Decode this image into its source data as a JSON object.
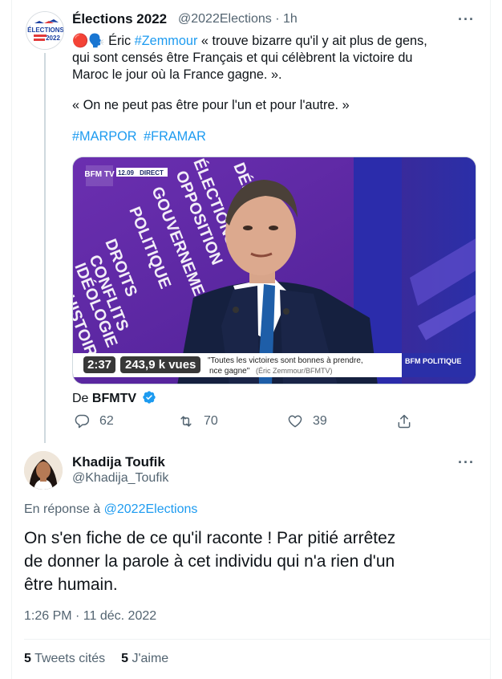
{
  "tweet": {
    "author_name": "Élections 2022",
    "author_handle": "@2022Elections · 1h",
    "text_emoji": "🔴🗣️",
    "text_prefix": "Éric",
    "text_mention": "#Zemmour",
    "text_line1_rest": "« trouve bizarre qu'il y ait plus de gens,",
    "text_line2": "qui sont censés être Français et qui célèbrent la victoire du",
    "text_line3": "Maroc le jour où la France gagne. ».",
    "text_quote": "« On ne peut pas être pour l'un et pour l'autre. »",
    "hashtags": [
      "#MARPOR",
      "#FRAMAR"
    ],
    "video": {
      "duration": "2:37",
      "views": "243,9 k vues",
      "channel_logo": "BFM TV",
      "live_time": "12.09",
      "live_label": "DIRECT",
      "background_words": [
        "DÉBAT",
        "ÉLECTIONS",
        "OPPOSITION",
        "GOUVERNEMENT",
        "POLITIQUE",
        "DROITS",
        "CONFLITS",
        "IDÉOLOGIE",
        "HISTOIRE"
      ],
      "caption_line1": "\"Toutes les victoires sont bonnes à prendre,",
      "caption_line2": "nce gagne\"",
      "caption_credit": "(Éric Zemmour/BFMTV)",
      "program": "BFM POLITIQUE"
    },
    "source_prefix": "De",
    "source_name": "BFMTV",
    "actions": {
      "replies": "62",
      "retweets": "70",
      "likes": "39"
    }
  },
  "reply": {
    "author_name": "Khadija Toufik",
    "author_handle": "@Khadija_Toufik",
    "reply_prefix": "En réponse à",
    "reply_to": "@2022Elections",
    "text_line1": "On s'en fiche de ce qu'il raconte ! Par pitié arrêtez",
    "text_line2": "de donner la parole à cet individu qui n'a rien d'un",
    "text_line3": "être humain.",
    "timestamp": "1:26 PM · 11 déc. 2022",
    "quote_count": "5",
    "quote_label": "Tweets cités",
    "like_count": "5",
    "like_label": "J'aime"
  },
  "colors": {
    "accent": "#1d9bf0",
    "secondary_text": "#536471",
    "primary_text": "#0f1419",
    "media_purple": "#5a2aa0"
  },
  "icons": [
    "more-icon",
    "reply-icon",
    "retweet-icon",
    "like-icon",
    "share-icon",
    "verified-icon"
  ]
}
